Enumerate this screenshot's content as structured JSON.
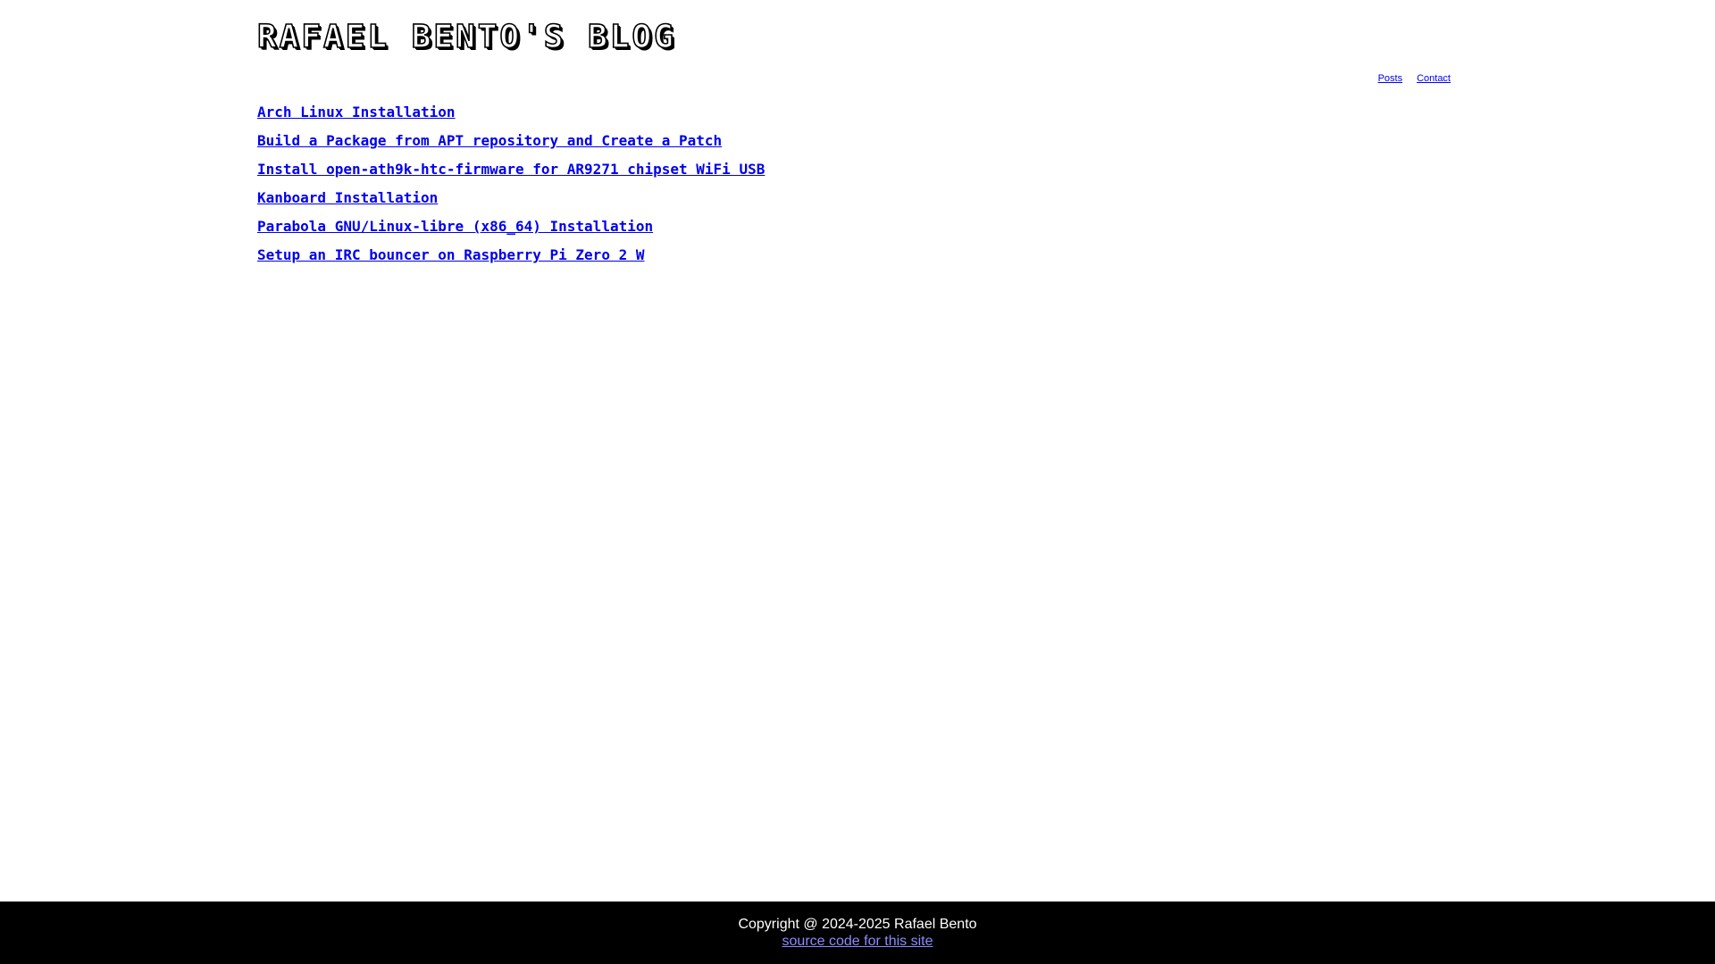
{
  "header": {
    "site_title": "Rafael Bento's Blog"
  },
  "nav": {
    "items": [
      {
        "label": "Posts"
      },
      {
        "label": "Contact"
      }
    ]
  },
  "posts": [
    {
      "title": "Arch Linux Installation"
    },
    {
      "title": "Build a Package from APT repository and Create a Patch"
    },
    {
      "title": "Install open-ath9k-htc-firmware for AR9271 chipset WiFi USB"
    },
    {
      "title": "Kanboard Installation"
    },
    {
      "title": "Parabola GNU/Linux-libre (x86_64) Installation"
    },
    {
      "title": "Setup an IRC bouncer on Raspberry Pi Zero 2 W"
    }
  ],
  "footer": {
    "copyright": "Copyright @ 2024-2025 Rafael Bento",
    "source_link": "source code for this site"
  },
  "colors": {
    "link": "#0000ee",
    "footer_bg": "#000000",
    "footer_link": "#8b8bff"
  }
}
